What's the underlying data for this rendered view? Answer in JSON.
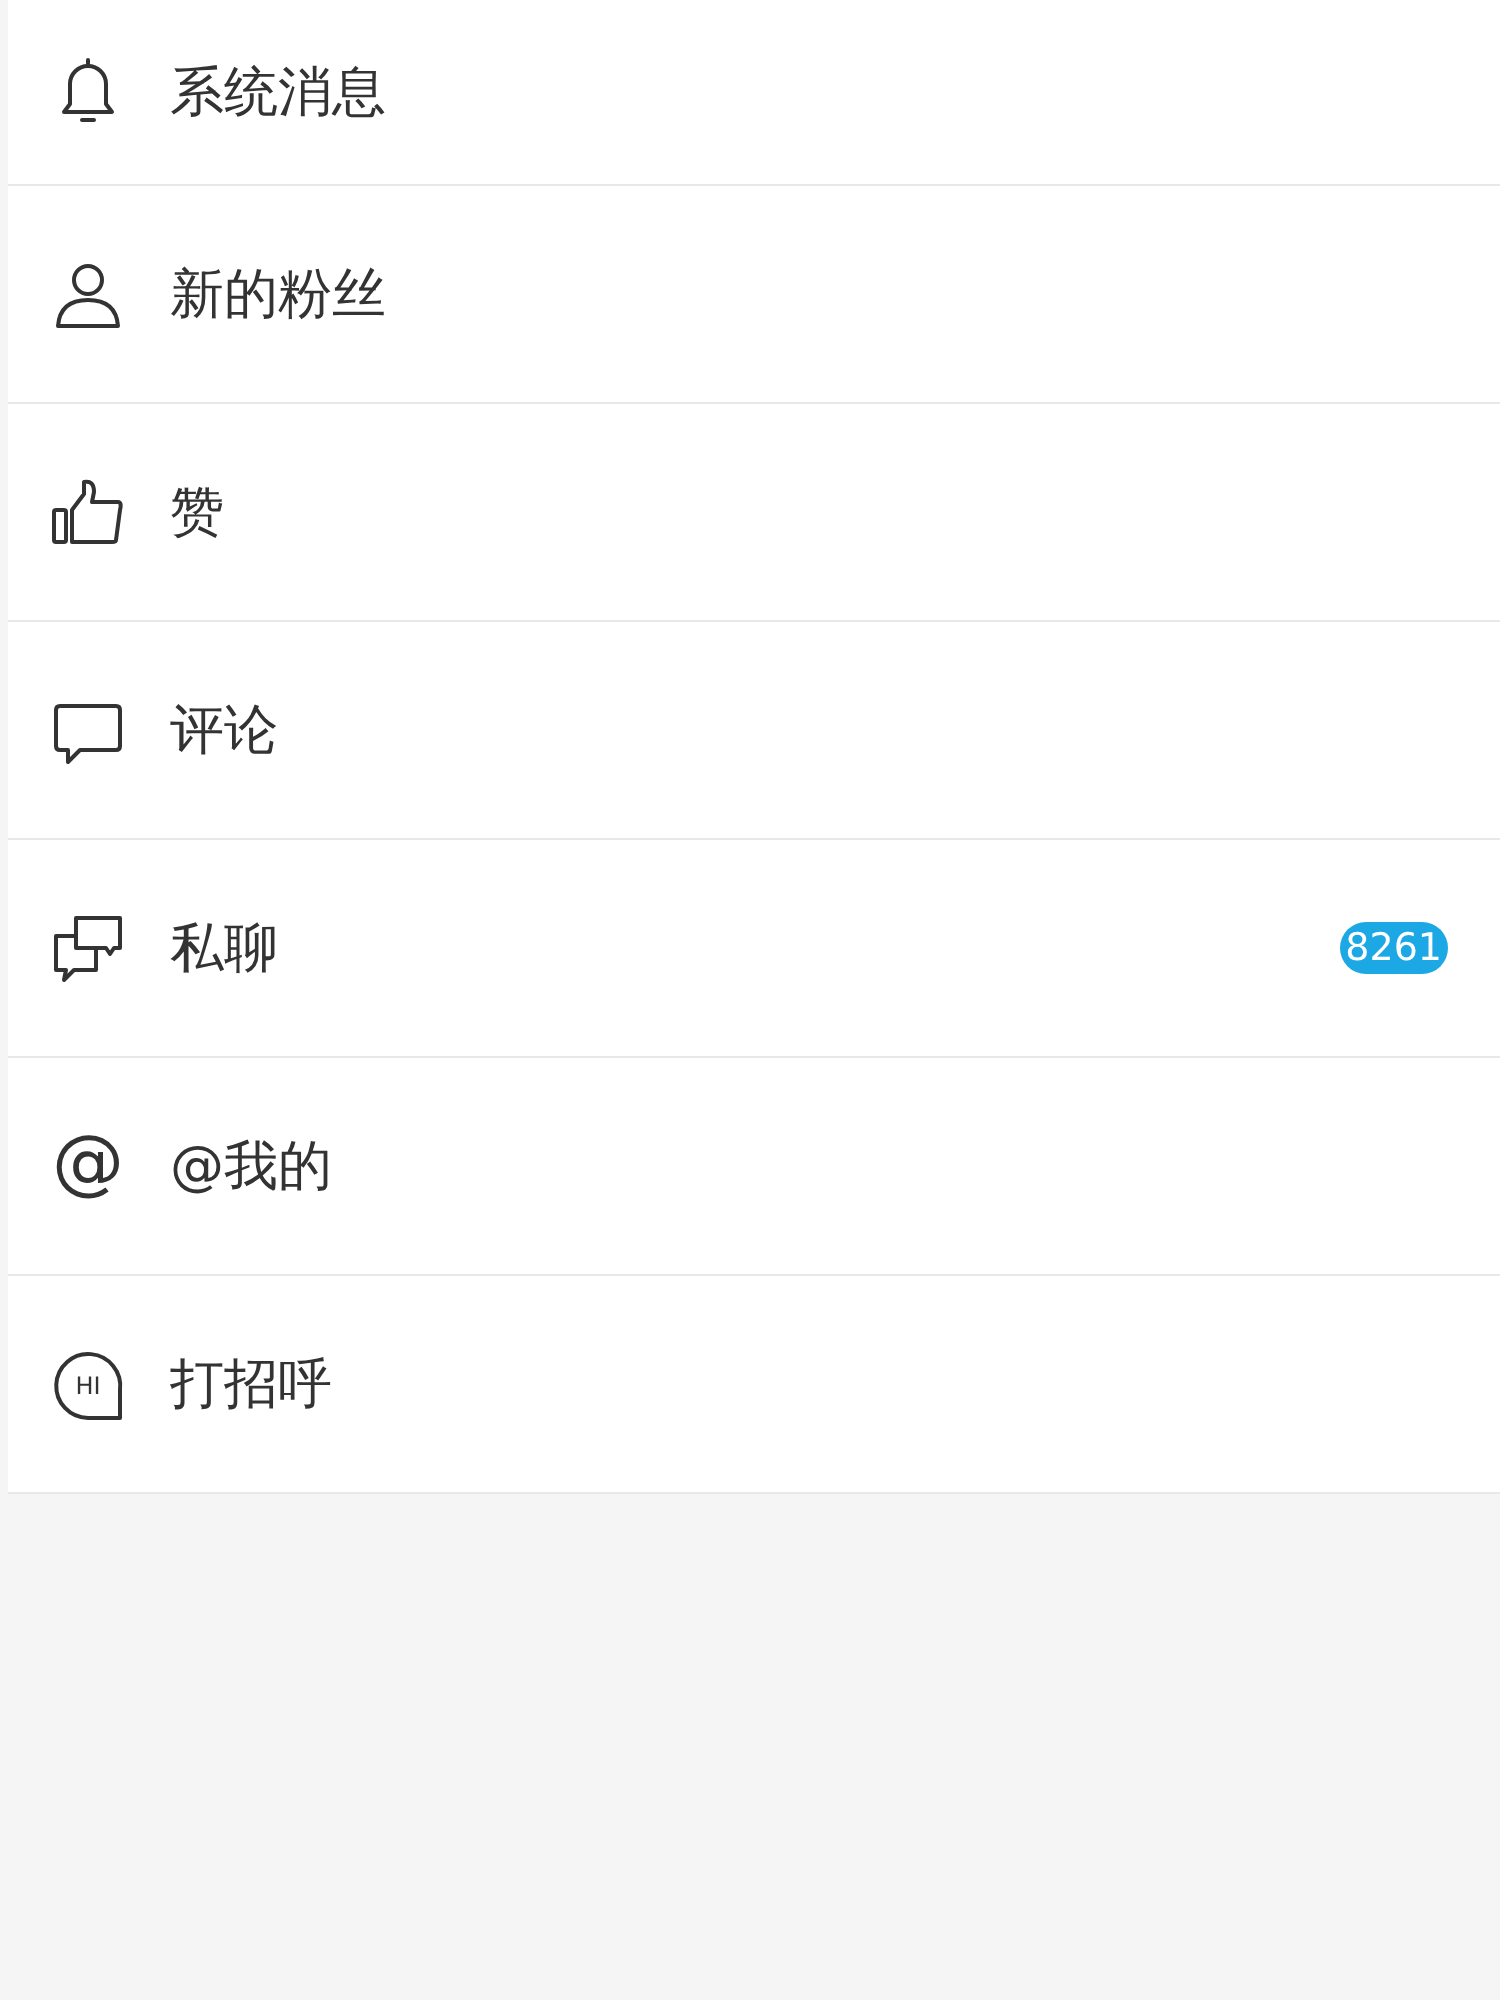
{
  "items": [
    {
      "kind": "bell",
      "label": "系统消息"
    },
    {
      "kind": "person",
      "label": "新的粉丝"
    },
    {
      "kind": "thumb",
      "label": "赞"
    },
    {
      "kind": "comment",
      "label": "评论"
    },
    {
      "kind": "chat",
      "label": "私聊",
      "badge": "8261"
    },
    {
      "kind": "at",
      "label": "@我的",
      "icon_text": "@"
    },
    {
      "kind": "hi",
      "label": "打招呼",
      "icon_text": "HI"
    }
  ]
}
